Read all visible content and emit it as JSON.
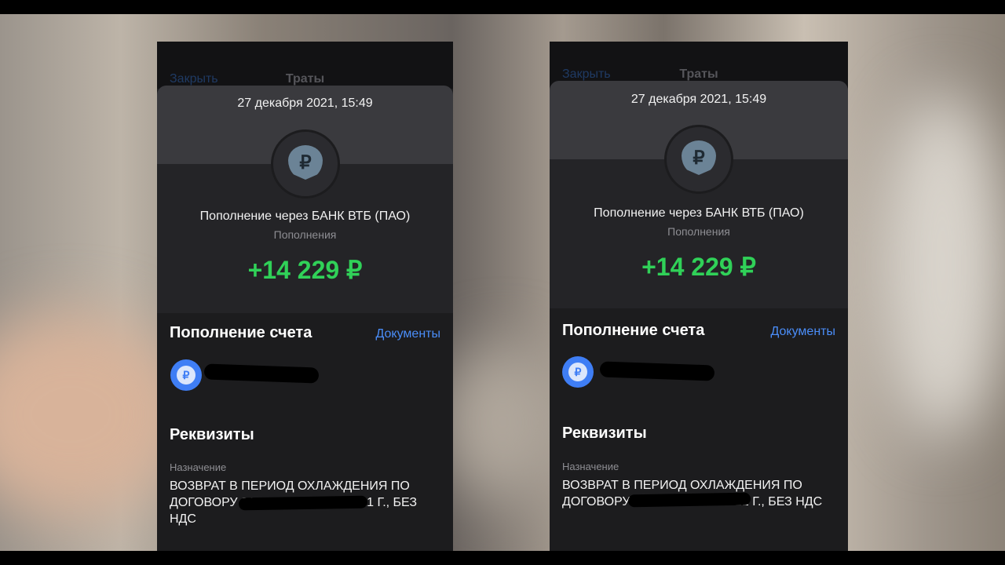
{
  "screens": [
    {
      "nav": {
        "close": "Закрыть",
        "title": "Траты"
      },
      "date": "27 декабря 2021, 15:49",
      "logo_icon": "ruble-shield-icon",
      "merchant": "Пополнение через БАНК ВТБ (ПАО)",
      "category": "Пополнения",
      "amount": "+14 229 ₽",
      "section_title": "Пополнение счета",
      "documents_link": "Документы",
      "account_icon": "ruble-coin-icon",
      "requisites_title": "Реквизиты",
      "purpose_label": "Назначение",
      "purpose_text": "ВОЗВРАТ В ПЕРИОД ОХЛАЖДЕНИЯ ПО ДОГОВОРУ 21                    4674 ОТ 15.12.2021 Г., БЕЗ НДС"
    },
    {
      "nav": {
        "close": "Закрыть",
        "title": "Траты"
      },
      "date": "27 декабря 2021, 15:49",
      "logo_icon": "ruble-shield-icon",
      "merchant": "Пополнение через БАНК ВТБ (ПАО)",
      "category": "Пополнения",
      "amount": "+14 229 ₽",
      "section_title": "Пополнение счета",
      "documents_link": "Документы",
      "account_icon": "ruble-coin-icon",
      "requisites_title": "Реквизиты",
      "purpose_label": "Назначение",
      "purpose_text": "ВОЗВРАТ В ПЕРИОД ОХЛАЖДЕНИЯ ПО ДОГОВОРУ                          3673 ОТ 15.12.2021 Г., БЕЗ НДС"
    }
  ],
  "colors": {
    "amount_green": "#30d158",
    "link_blue": "#4a8df8",
    "card_dark": "#1c1c1e"
  }
}
